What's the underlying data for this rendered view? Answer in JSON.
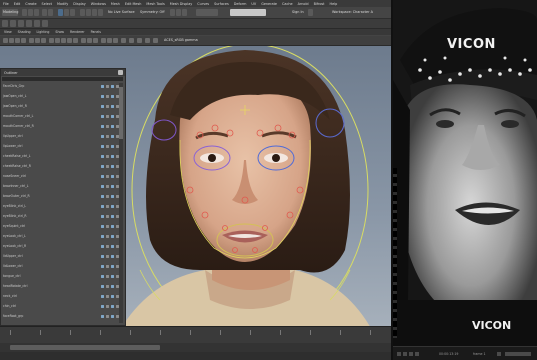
{
  "maya": {
    "menu": [
      "File",
      "Edit",
      "Create",
      "Select",
      "Modify",
      "Display",
      "Windows",
      "Mesh",
      "Edit Mesh",
      "Mesh Tools",
      "Mesh Display",
      "Curves",
      "Surfaces",
      "Deform",
      "UV",
      "Generate",
      "Cache",
      "Arnold",
      "Bifrost",
      "Help"
    ],
    "status": {
      "mode": "Modeling",
      "no_live": "No Live Surface",
      "symmetry": "Symmetry: Off",
      "sign_in": "Sign In",
      "workspace": "Workspace: Character A"
    },
    "panel_menu": [
      "View",
      "Shading",
      "Lighting",
      "Show",
      "Renderer",
      "Panels"
    ],
    "camera_label": "ACES_sRGB gamma",
    "outliner": {
      "title": "Outliner",
      "rows": [
        "FaceCtrls_Grp",
        "jawOpen_ctrl_L",
        "jawOpen_ctrl_R",
        "mouthCorner_ctrl_L",
        "mouthCorner_ctrl_R",
        "lipUpper_ctrl",
        "lipLower_ctrl",
        "cheekRaise_ctrl_L",
        "cheekRaise_ctrl_R",
        "noseSneer_ctrl",
        "browInner_ctrl_L",
        "browOuter_ctrl_R",
        "eyeBlink_ctrl_L",
        "eyeBlink_ctrl_R",
        "eyeSquint_ctrl",
        "eyeLook_ctrl_L",
        "eyeLook_ctrl_R",
        "lidUpper_ctrl",
        "lidLower_ctrl",
        "tongue_ctrl",
        "headRotate_ctrl",
        "neck_ctrl",
        "chin_ctrl",
        "faceRoot_grp"
      ]
    }
  },
  "video": {
    "brand": "VICON",
    "controls": {
      "timecode": "00:00:13:19",
      "frame": "frame 1"
    }
  }
}
